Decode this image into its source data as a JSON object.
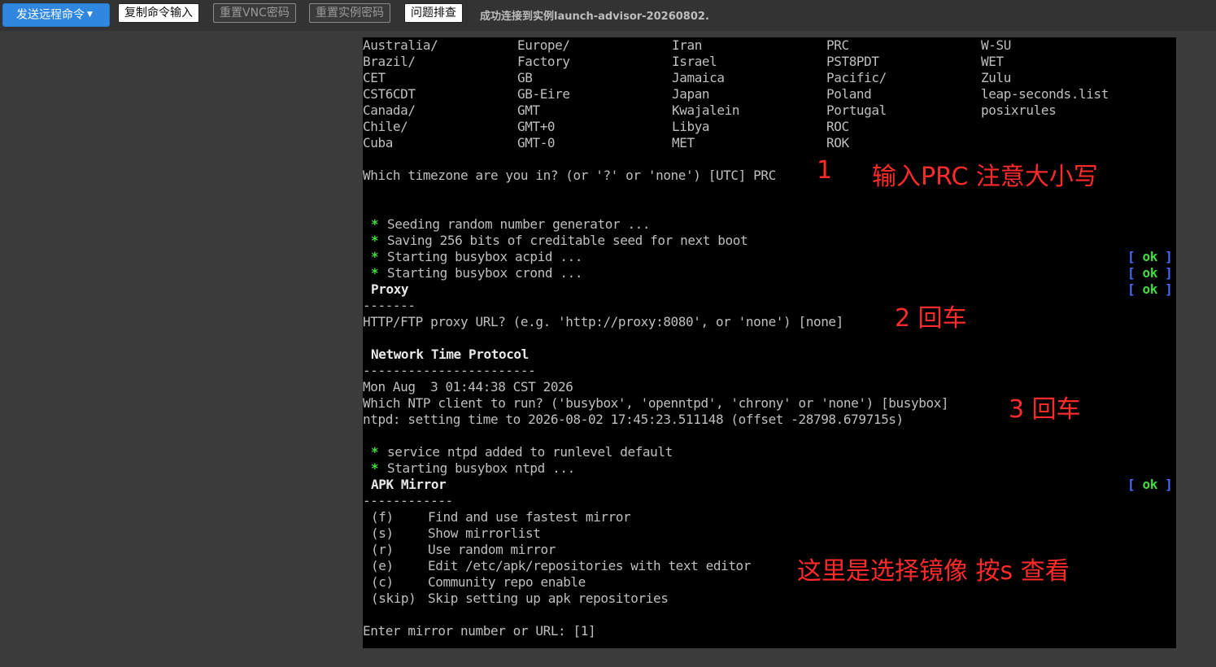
{
  "toolbar": {
    "send_command": "发送远程命令",
    "copy_input": "复制命令输入",
    "reset_vnc": "重置VNC密码",
    "reset_instance": "重置实例密码",
    "troubleshoot": "问题排查",
    "status": "成功连接到实例launch-advisor-20260802."
  },
  "tz_table": [
    [
      "Australia/",
      "Europe/",
      "Iran",
      "PRC",
      "W-SU"
    ],
    [
      "Brazil/",
      "Factory",
      "Israel",
      "PST8PDT",
      "WET"
    ],
    [
      "CET",
      "GB",
      "Jamaica",
      "Pacific/",
      "Zulu"
    ],
    [
      "CST6CDT",
      "GB-Eire",
      "Japan",
      "Poland",
      "leap-seconds.list"
    ],
    [
      "Canada/",
      "GMT",
      "Kwajalein",
      "Portugal",
      "posixrules"
    ],
    [
      "Chile/",
      "GMT+0",
      "Libya",
      "ROC",
      ""
    ],
    [
      "Cuba",
      "GMT-0",
      "MET",
      "ROK",
      ""
    ]
  ],
  "terminal": {
    "tz_prompt": "Which timezone are you in? (or '?' or 'none') [UTC] PRC",
    "seed_1": "Seeding random number generator ...",
    "seed_2": "Saving 256 bits of creditable seed for next boot",
    "acpid": "Starting busybox acpid ...",
    "crond": "Starting busybox crond ...",
    "star": "*",
    "ok_open": "[",
    "ok_word": "ok",
    "ok_close": "]",
    "proxy_title": "Proxy",
    "proxy_rule": "-------",
    "proxy_prompt": "HTTP/FTP proxy URL? (e.g. 'http://proxy:8080', or 'none') [none]",
    "ntp_title": "Network Time Protocol",
    "ntp_rule": "-----------------------",
    "date_line": "Mon Aug  3 01:44:38 CST 2026",
    "ntp_prompt": "Which NTP client to run? ('busybox', 'openntpd', 'chrony' or 'none') [busybox]",
    "ntpd_line": "ntpd: setting time to 2026-08-02 17:45:23.511148 (offset -28798.679715s)",
    "ntp_added": "service ntpd added to runlevel default",
    "ntp_start": "Starting busybox ntpd ...",
    "apk_title": "APK Mirror",
    "apk_rule": "------------",
    "mirror_options": [
      {
        "key": "(f)",
        "text": "Find and use fastest mirror"
      },
      {
        "key": "(s)",
        "text": "Show mirrorlist"
      },
      {
        "key": "(r)",
        "text": "Use random mirror"
      },
      {
        "key": "(e)",
        "text": "Edit /etc/apk/repositories with text editor"
      },
      {
        "key": "(c)",
        "text": "Community repo enable"
      },
      {
        "key": "(skip)",
        "text": "Skip setting up apk repositories"
      }
    ],
    "mirror_prompt": "Enter mirror number or URL: [1]"
  },
  "annotations": {
    "step1_num": "1",
    "step1_text": "输入PRC 注意大小写",
    "step2": "2 回车",
    "step3": "3 回车",
    "step4": "这里是选择镜像 按s 查看"
  }
}
